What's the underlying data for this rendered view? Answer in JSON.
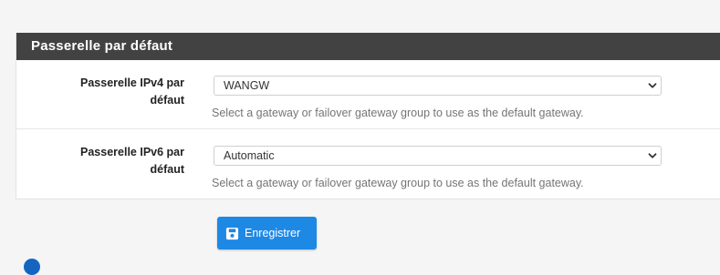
{
  "panel": {
    "title": "Passerelle par défaut"
  },
  "rows": [
    {
      "label_line1": "Passerelle IPv4 par",
      "label_line2": "défaut",
      "select_value": "WANGW",
      "help": "Select a gateway or failover gateway group to use as the default gateway."
    },
    {
      "label_line1": "Passerelle IPv6 par",
      "label_line2": "défaut",
      "select_value": "Automatic",
      "help": "Select a gateway or failover gateway group to use as the default gateway."
    }
  ],
  "actions": {
    "save_label": "Enregistrer",
    "save_icon": "floppy-disk-icon"
  },
  "colors": {
    "panel_heading_bg": "#424242",
    "primary_button": "#1e88e5",
    "help_text": "#757575"
  }
}
